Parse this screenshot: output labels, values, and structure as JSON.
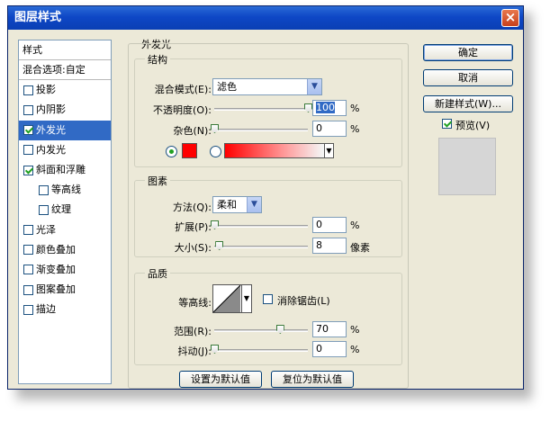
{
  "window": {
    "title": "图层样式",
    "close_glyph": "×"
  },
  "styles_panel": {
    "header": "样式",
    "blend_options": "混合选项:自定",
    "items": [
      {
        "label": "投影",
        "checked": false,
        "sub": false,
        "selected": false
      },
      {
        "label": "内阴影",
        "checked": false,
        "sub": false,
        "selected": false
      },
      {
        "label": "外发光",
        "checked": true,
        "sub": false,
        "selected": true
      },
      {
        "label": "内发光",
        "checked": false,
        "sub": false,
        "selected": false
      },
      {
        "label": "斜面和浮雕",
        "checked": true,
        "sub": false,
        "selected": false
      },
      {
        "label": "等高线",
        "checked": false,
        "sub": true,
        "selected": false
      },
      {
        "label": "纹理",
        "checked": false,
        "sub": true,
        "selected": false
      },
      {
        "label": "光泽",
        "checked": false,
        "sub": false,
        "selected": false
      },
      {
        "label": "颜色叠加",
        "checked": false,
        "sub": false,
        "selected": false
      },
      {
        "label": "渐变叠加",
        "checked": false,
        "sub": false,
        "selected": false
      },
      {
        "label": "图案叠加",
        "checked": false,
        "sub": false,
        "selected": false
      },
      {
        "label": "描边",
        "checked": false,
        "sub": false,
        "selected": false
      }
    ]
  },
  "outer_glow": {
    "title": "外发光",
    "structure": {
      "title": "结构",
      "blend_mode_label": "混合模式(E):",
      "blend_mode_value": "滤色",
      "opacity_label": "不透明度(O):",
      "opacity_value": "100",
      "opacity_unit": "%",
      "opacity_level": 1.0,
      "noise_label": "杂色(N):",
      "noise_value": "0",
      "noise_unit": "%",
      "noise_level": 0.0,
      "glow_color": "#ff0000"
    },
    "elements": {
      "title": "图素",
      "technique_label": "方法(Q):",
      "technique_value": "柔和",
      "spread_label": "扩展(P):",
      "spread_value": "0",
      "spread_unit": "%",
      "spread_level": 0.0,
      "size_label": "大小(S):",
      "size_value": "8",
      "size_unit": "像素",
      "size_level": 0.05
    },
    "quality": {
      "title": "品质",
      "contour_label": "等高线:",
      "antialias_label": "消除锯齿(L)",
      "antialias_checked": false,
      "range_label": "范围(R):",
      "range_value": "70",
      "range_unit": "%",
      "range_level": 0.7,
      "jitter_label": "抖动(J):",
      "jitter_value": "0",
      "jitter_unit": "%",
      "jitter_level": 0.0
    },
    "make_default": "设置为默认值",
    "reset_default": "复位为默认值"
  },
  "buttons": {
    "ok": "确定",
    "cancel": "取消",
    "new_style": "新建样式(W)...",
    "preview_label": "预览(V)",
    "preview_checked": true
  }
}
